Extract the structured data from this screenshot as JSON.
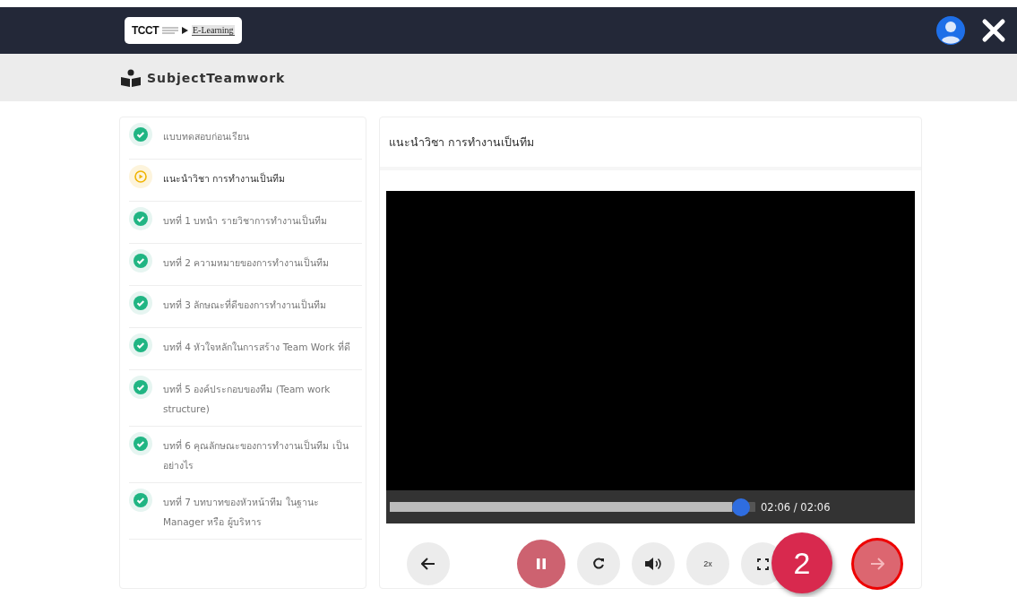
{
  "header": {
    "logo_text": "TCCT",
    "logo_link": "E-Learning"
  },
  "subject": {
    "title": "SubjectTeamwork"
  },
  "lessons": [
    {
      "title": "แบบทดสอบก่อนเรียน",
      "kind": "done",
      "selected": false
    },
    {
      "title": "แนะนำวิชา การทำงานเป็นทีม",
      "kind": "playing",
      "selected": true
    },
    {
      "title": "บทที่ 1 บทนำ รายวิชาการทำงานเป็นทีม",
      "kind": "done",
      "selected": false
    },
    {
      "title": "บทที่ 2 ความหมายของการทำงานเป็นทีม",
      "kind": "done",
      "selected": false
    },
    {
      "title": "บทที่ 3 ลักษณะที่ดีของการทำงานเป็นทีม",
      "kind": "done",
      "selected": false
    },
    {
      "title": "บทที่ 4 หัวใจหลักในการสร้าง Team Work ที่ดี",
      "kind": "done",
      "selected": false
    },
    {
      "title": "บทที่ 5 องค์ประกอบของทีม (Team work structure)",
      "kind": "done",
      "selected": false
    },
    {
      "title": "บทที่ 6 คุณลักษณะของการทำงานเป็นทีม เป็นอย่างไร",
      "kind": "done",
      "selected": false
    },
    {
      "title": "บทที่ 7 บทบาทของหัวหน้าทีม ในฐานะ Manager หรือ ผู้บริหาร",
      "kind": "done",
      "selected": false
    }
  ],
  "player": {
    "title": "แนะนำวิชา การทำงานเป็นทีม",
    "level": 0.985,
    "time": "02:06 / 02:06",
    "controls": [
      {
        "kind": "back"
      },
      {
        "kind": "pause"
      },
      {
        "kind": "replay"
      },
      {
        "kind": "volume"
      },
      {
        "kind": "speed",
        "label": "2x"
      },
      {
        "kind": "fullscreen"
      }
    ],
    "next": {
      "highlighted": true
    },
    "callout": {
      "text": "2"
    }
  }
}
